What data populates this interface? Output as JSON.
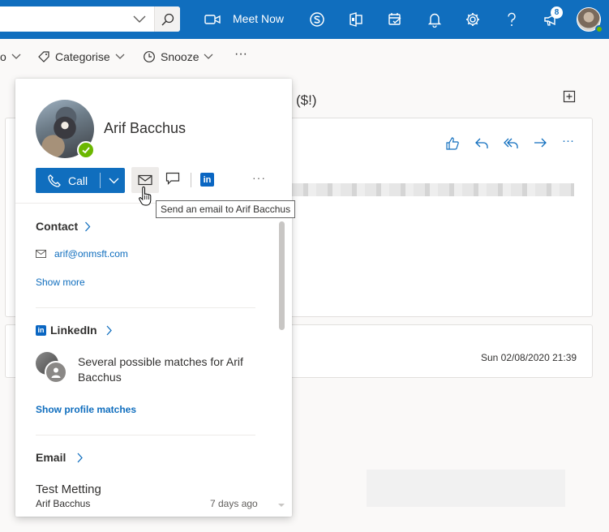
{
  "topbar": {
    "meet_now_label": "Meet Now",
    "notification_count": "8",
    "icons": [
      "chevron-down-icon",
      "search-icon",
      "video-icon",
      "skype-icon",
      "office-icon",
      "calendar-check-icon",
      "bell-icon",
      "gear-icon",
      "help-icon",
      "megaphone-icon"
    ],
    "accent": "#106ebe"
  },
  "cmdbar": {
    "partial_label": "o",
    "categorise_label": "Categorise",
    "snooze_label": "Snooze",
    "more_label": "···"
  },
  "reading": {
    "subject_fragment": "($!)",
    "date": "Sun 02/08/2020 21:39",
    "actions_more": "···"
  },
  "popup": {
    "name": "Arif Bacchus",
    "call_label": "Call",
    "more_label": "···",
    "contact_title": "Contact",
    "email": "arif@onmsft.com",
    "show_more": "Show more",
    "linkedin_title": "LinkedIn",
    "linkedin_logo_text": "in",
    "linkedin_match_text": "Several possible matches for Arif Bacchus",
    "show_profile_matches": "Show profile matches",
    "email_title": "Email",
    "mail_subject": "Test Metting",
    "mail_from": "Arif Bacchus",
    "mail_time": "7 days ago",
    "presence_color": "#6bb700"
  },
  "tooltip": {
    "text": "Send an email to Arif Bacchus"
  }
}
